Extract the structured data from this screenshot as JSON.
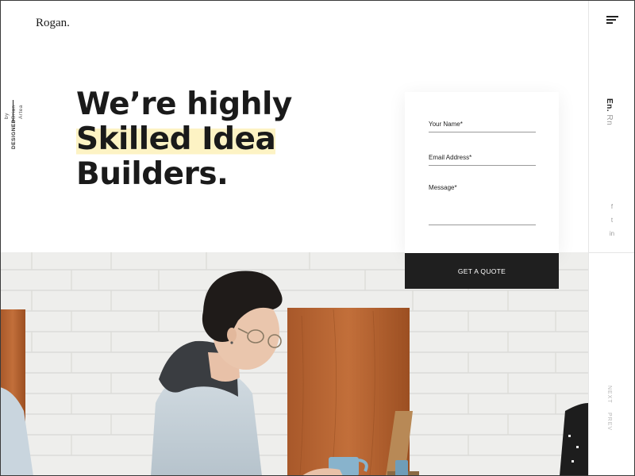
{
  "brand": {
    "logo": "Rogan."
  },
  "credit": {
    "line1": "DESIGNED",
    "line2": "by Brian Artea"
  },
  "hero": {
    "line1": "We’re highly",
    "line2": "Skilled Idea",
    "line3": "Builders."
  },
  "form": {
    "name_label": "Your Name*",
    "email_label": "Email Address*",
    "message_label": "Message*",
    "submit_label": "GET A QUOTE"
  },
  "rail": {
    "lang_active": "En.",
    "lang_other": "Rn",
    "social": [
      "f",
      "t",
      "in"
    ],
    "next_label": "NEXT",
    "prev_label": "PREV"
  },
  "icons": {
    "menu": "menu-icon",
    "facebook": "facebook-icon",
    "twitter": "twitter-icon",
    "linkedin": "linkedin-icon"
  },
  "colors": {
    "accent_highlight": "#fdf3c4",
    "button_bg": "#1f1f1f",
    "text": "#1a1a1a"
  }
}
